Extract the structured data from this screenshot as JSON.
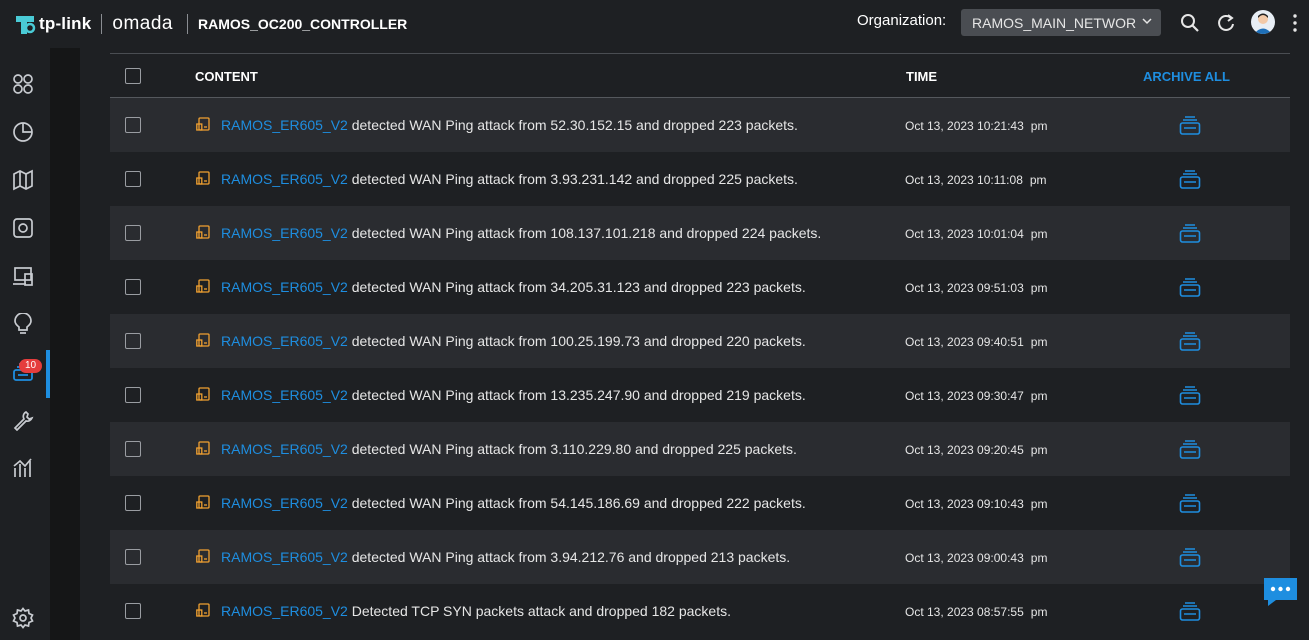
{
  "app": {
    "brand": "tp-link",
    "product": "omada",
    "controller_name": "RAMOS_OC200_CONTROLLER",
    "org_label": "Organization:",
    "org_value": "RAMOS_MAIN_NETWOR"
  },
  "sidebar": {
    "items": [
      {
        "icon": "dashboard-icon"
      },
      {
        "icon": "statistics-icon"
      },
      {
        "icon": "map-icon"
      },
      {
        "icon": "devices-icon"
      },
      {
        "icon": "clients-icon"
      },
      {
        "icon": "insight-icon"
      },
      {
        "icon": "logs-icon",
        "badge": "10",
        "active": true
      },
      {
        "icon": "tools-icon"
      },
      {
        "icon": "reports-icon"
      }
    ],
    "settings_icon": "gear-icon"
  },
  "table": {
    "headers": {
      "content": "CONTENT",
      "time": "TIME",
      "archive_all": "ARCHIVE ALL"
    },
    "rows": [
      {
        "device": "RAMOS_ER605_V2",
        "message": " detected WAN Ping attack from 52.30.152.15 and dropped 223 packets.",
        "time": "Oct 13, 2023 10:21:43",
        "ampm": "pm"
      },
      {
        "device": "RAMOS_ER605_V2",
        "message": " detected WAN Ping attack from 3.93.231.142 and dropped 225 packets.",
        "time": "Oct 13, 2023 10:11:08",
        "ampm": "pm"
      },
      {
        "device": "RAMOS_ER605_V2",
        "message": " detected WAN Ping attack from 108.137.101.218 and dropped 224 packets.",
        "time": "Oct 13, 2023 10:01:04",
        "ampm": "pm"
      },
      {
        "device": "RAMOS_ER605_V2",
        "message": " detected WAN Ping attack from 34.205.31.123 and dropped 223 packets.",
        "time": "Oct 13, 2023 09:51:03",
        "ampm": "pm"
      },
      {
        "device": "RAMOS_ER605_V2",
        "message": " detected WAN Ping attack from 100.25.199.73 and dropped 220 packets.",
        "time": "Oct 13, 2023 09:40:51",
        "ampm": "pm"
      },
      {
        "device": "RAMOS_ER605_V2",
        "message": " detected WAN Ping attack from 13.235.247.90 and dropped 219 packets.",
        "time": "Oct 13, 2023 09:30:47",
        "ampm": "pm"
      },
      {
        "device": "RAMOS_ER605_V2",
        "message": " detected WAN Ping attack from 3.110.229.80 and dropped 225 packets.",
        "time": "Oct 13, 2023 09:20:45",
        "ampm": "pm"
      },
      {
        "device": "RAMOS_ER605_V2",
        "message": " detected WAN Ping attack from 54.145.186.69 and dropped 222 packets.",
        "time": "Oct 13, 2023 09:10:43",
        "ampm": "pm"
      },
      {
        "device": "RAMOS_ER605_V2",
        "message": " detected WAN Ping attack from 3.94.212.76 and dropped 213 packets.",
        "time": "Oct 13, 2023 09:00:43",
        "ampm": "pm"
      },
      {
        "device": "RAMOS_ER605_V2",
        "message": " Detected TCP SYN packets attack and dropped 182 packets.",
        "time": "Oct 13, 2023 08:57:55",
        "ampm": "pm"
      }
    ]
  },
  "colors": {
    "accent": "#1e8ee0",
    "device_icon": "#f0a030",
    "badge": "#e53d3d"
  }
}
